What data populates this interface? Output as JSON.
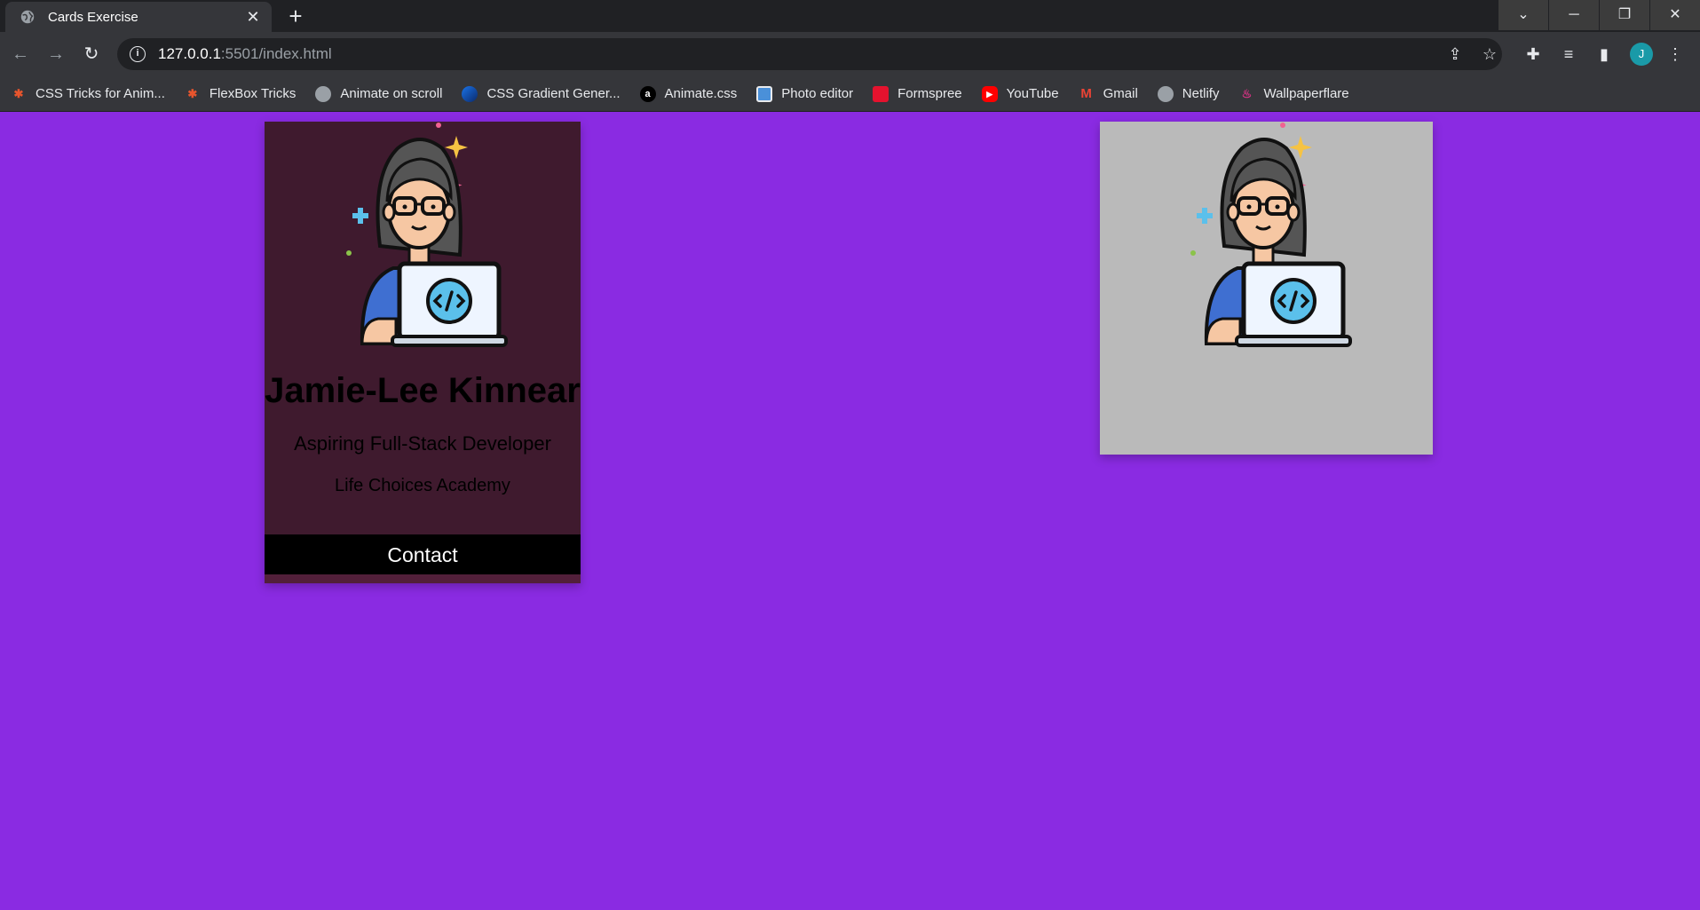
{
  "browser": {
    "tab_title": "Cards Exercise",
    "url_host": "127.0.0.1",
    "url_path": ":5501/index.html",
    "profile_initial": "J",
    "bookmarks": [
      {
        "label": "CSS Tricks for Anim...",
        "icon": "asterisk-icon",
        "color": "#e8552d"
      },
      {
        "label": "FlexBox Tricks",
        "icon": "asterisk-icon",
        "color": "#e8552d"
      },
      {
        "label": "Animate on scroll",
        "icon": "globe-icon",
        "color": "#9aa0a6"
      },
      {
        "label": "CSS Gradient Gener...",
        "icon": "gradient-icon",
        "color": "#1a73e8"
      },
      {
        "label": "Animate.css",
        "icon": "a-icon",
        "color": "#000000"
      },
      {
        "label": "Photo editor",
        "icon": "photo-icon",
        "color": "#4a90d9"
      },
      {
        "label": "Formspree",
        "icon": "formspree-icon",
        "color": "#e5122e"
      },
      {
        "label": "YouTube",
        "icon": "youtube-icon",
        "color": "#ff0000"
      },
      {
        "label": "Gmail",
        "icon": "gmail-icon",
        "color": "#ea4335"
      },
      {
        "label": "Netlify",
        "icon": "globe-icon",
        "color": "#9aa0a6"
      },
      {
        "label": "Wallpaperflare",
        "icon": "flame-icon",
        "color": "#d63384"
      }
    ]
  },
  "card": {
    "name": "Jamie-Lee Kinnear",
    "role": "Aspiring Full-Stack Developer",
    "school": "Life Choices Academy",
    "contact_label": "Contact"
  },
  "colors": {
    "page_background": "#8a2be2",
    "card_background": "#3f1a2e",
    "card2_background": "#bababa"
  }
}
